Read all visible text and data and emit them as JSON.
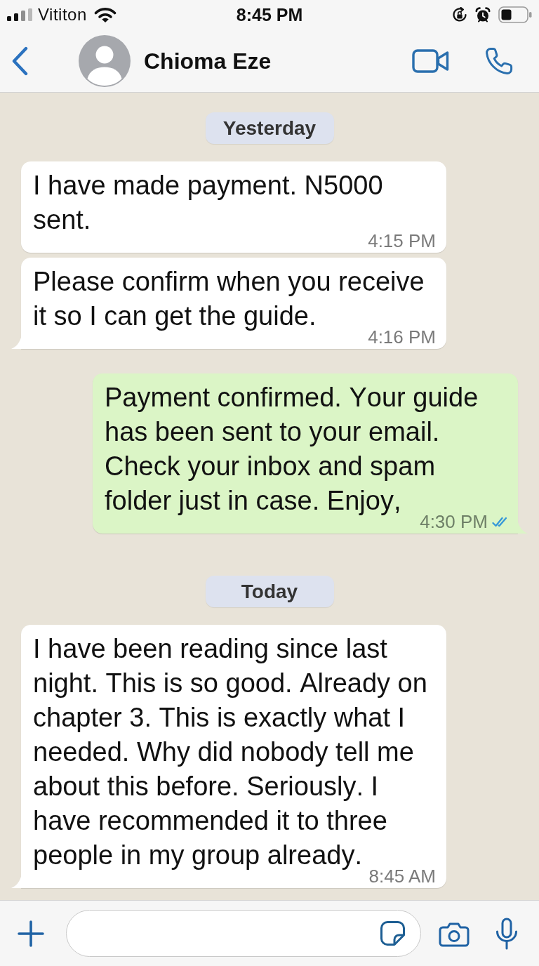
{
  "status_bar": {
    "carrier": "Vititon",
    "time": "8:45 PM"
  },
  "header": {
    "contact_name": "Chioma Eze"
  },
  "messages": [
    {
      "kind": "date",
      "text": "Yesterday"
    },
    {
      "kind": "incoming",
      "text": "I have made payment. N5000 sent.",
      "time": "4:15 PM"
    },
    {
      "kind": "incoming",
      "text": "Please confirm when you receive it so I can get the guide.",
      "time": "4:16 PM"
    },
    {
      "kind": "outgoing",
      "text": "Payment confirmed. Your guide has been sent to your email. Check your inbox and spam folder just in case. Enjoy,",
      "time": "4:30 PM",
      "read": true
    },
    {
      "kind": "date",
      "text": "Today"
    },
    {
      "kind": "incoming",
      "text": "I have been reading since last night. This is so good. Already on chapter 3. This is exactly what I needed. Why did nobody tell me about this before. Seriously. I have recommended it to three people in my group already.",
      "time": "8:45 AM"
    }
  ]
}
